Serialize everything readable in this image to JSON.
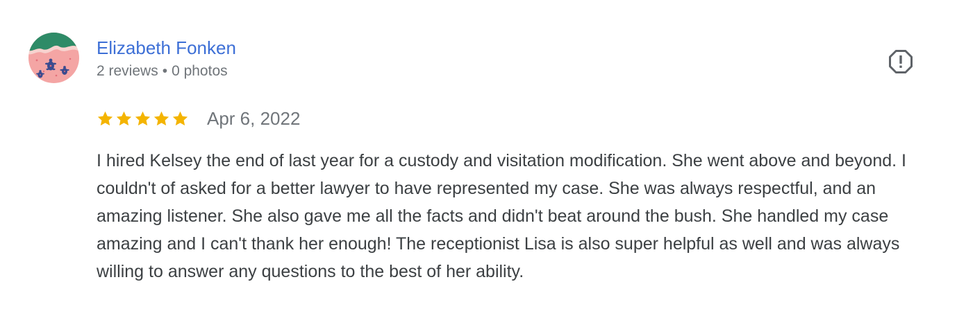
{
  "review": {
    "author": {
      "name": "Elizabeth Fonken",
      "reviews_count": "2 reviews",
      "separator": "•",
      "photos_count": "0 photos",
      "avatar_icon": "sea-turtles-beach-avatar-icon"
    },
    "report_icon": "report-flag-icon",
    "rating": {
      "stars": 5,
      "max_stars": 5,
      "star_color": "#f4b400"
    },
    "date": "Apr 6, 2022",
    "text": "I hired Kelsey the end of last year for a custody and visitation modification. She went above and beyond. I couldn't of asked for a better lawyer to have represented my case. She was always respectful, and an amazing listener. She also gave me all the facts and didn't beat around the bush. She handled my case amazing and I can't thank her enough! The receptionist Lisa is also super helpful as well and was always willing to answer any questions to the best of her ability."
  },
  "colors": {
    "author_link": "#3d6fd6",
    "secondary_text": "#70757a",
    "body_text": "#3c4043",
    "icon": "#5f6368"
  }
}
